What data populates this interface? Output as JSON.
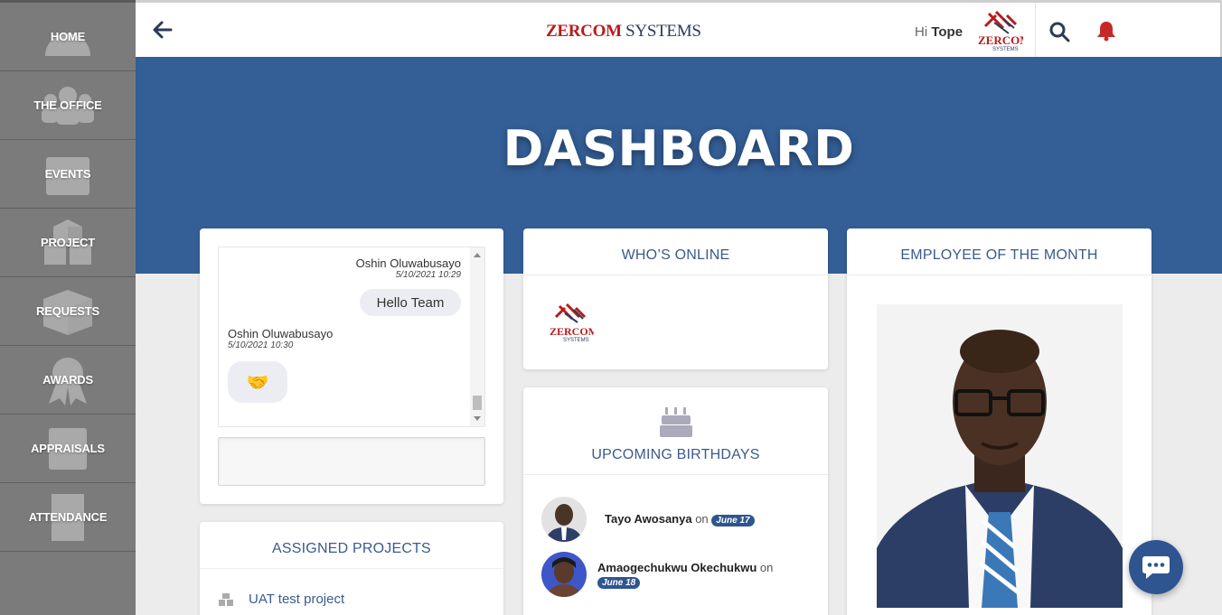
{
  "sidebar": {
    "items": [
      {
        "label": "HOME",
        "icon": "home-icon"
      },
      {
        "label": "THE OFFICE",
        "icon": "people-icon"
      },
      {
        "label": "EVENTS",
        "icon": "calendar-icon"
      },
      {
        "label": "PROJECT",
        "icon": "cubes-icon"
      },
      {
        "label": "REQUESTS",
        "icon": "box-icon"
      },
      {
        "label": "AWARDS",
        "icon": "award-icon"
      },
      {
        "label": "APPRAISALS",
        "icon": "grade-icon"
      },
      {
        "label": "ATTENDANCE",
        "icon": "building-icon"
      }
    ]
  },
  "header": {
    "brand_part1": "ZERCOM",
    "brand_part2": "SYSTEMS",
    "greeting_prefix": "Hi",
    "user_name": "Tope",
    "accent": "#b71c1c"
  },
  "hero": {
    "title": "DASHBOARD",
    "color": "#335e96"
  },
  "chat": {
    "messages": [
      {
        "sender": "Oshin Oluwabusayo",
        "time": "5/10/2021 10:29",
        "text": "Hello Team"
      },
      {
        "sender": "Oshin Oluwabusayo",
        "time": "5/10/2021 10:30",
        "text": "🤝"
      }
    ]
  },
  "assigned_projects": {
    "title": "ASSIGNED PROJECTS",
    "items": [
      {
        "label": "UAT test project"
      }
    ]
  },
  "whos_online": {
    "title": "WHO’S ONLINE"
  },
  "birthdays": {
    "title": "UPCOMING BIRTHDAYS",
    "on_word": "on",
    "people": [
      {
        "name": "Tayo Awosanya",
        "date": "June 17"
      },
      {
        "name": "Amaogechukwu Okechukwu",
        "date": "June 18"
      }
    ]
  },
  "employee_of_month": {
    "title": "EMPLOYEE OF THE MONTH"
  }
}
